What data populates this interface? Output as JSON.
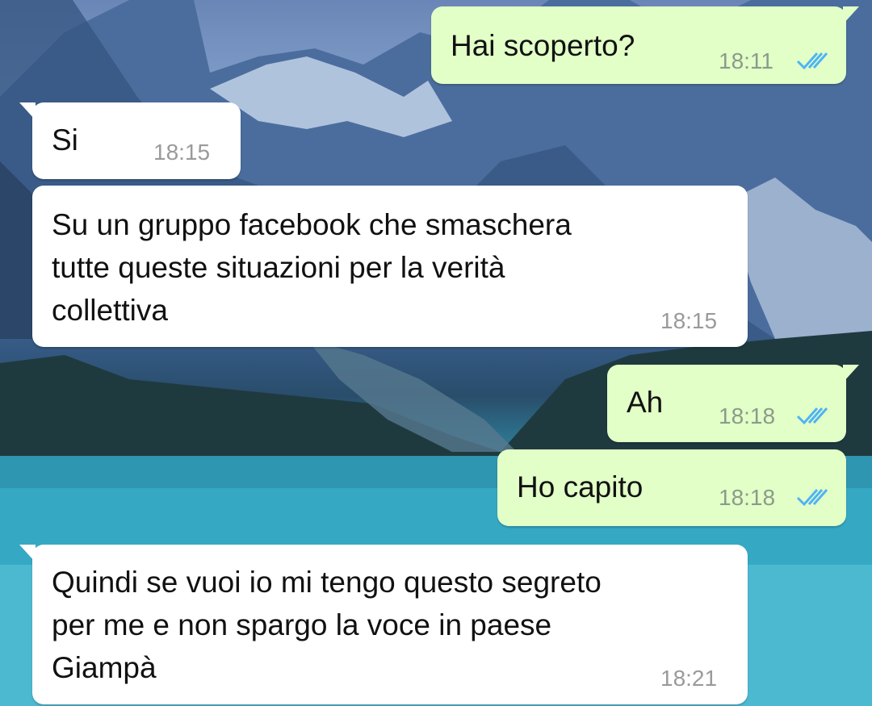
{
  "theme": {
    "outgoing_bubble_color": "#e2ffc7",
    "incoming_bubble_color": "#ffffff",
    "read_tick_color": "#4fb3f5"
  },
  "messages": [
    {
      "direction": "outgoing",
      "text": "Hai scoperto?",
      "time": "18:11",
      "status_icon": "double-check-read-icon"
    },
    {
      "direction": "incoming",
      "text": "Si",
      "time": "18:15"
    },
    {
      "direction": "incoming",
      "text": "Su un gruppo facebook che smaschera\ntutte queste situazioni per la verità\ncollettiva",
      "time": "18:15"
    },
    {
      "direction": "outgoing",
      "text": "Ah",
      "time": "18:18",
      "status_icon": "double-check-read-icon"
    },
    {
      "direction": "outgoing",
      "text": "Ho capito",
      "time": "18:18",
      "status_icon": "double-check-read-icon"
    },
    {
      "direction": "incoming",
      "text": "Quindi se vuoi io mi tengo questo segreto\nper me e non spargo la voce in paese\nGiampà",
      "time": "18:21"
    }
  ]
}
